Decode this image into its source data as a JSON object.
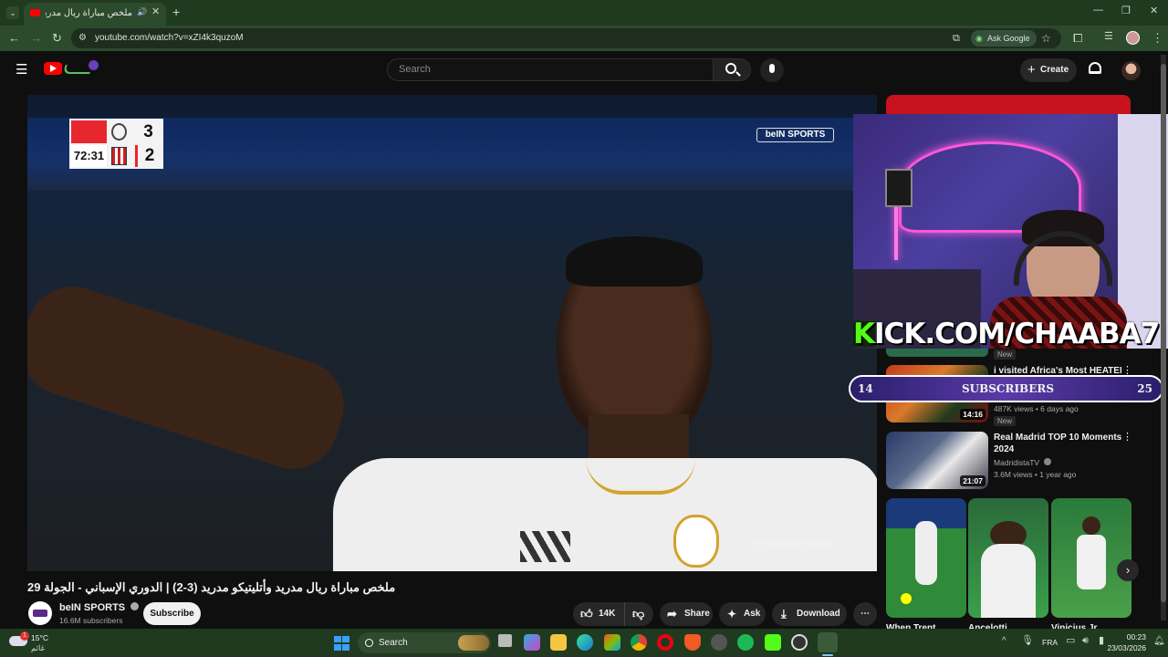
{
  "browser": {
    "tab_title": "ملخص مباراة ريال مدريد وأتل",
    "url": "youtube.com/watch?v=xZI4k3quzoM",
    "ask_google": "Ask Google",
    "new_tab_symbol": "+"
  },
  "youtube": {
    "search_placeholder": "Search",
    "create_label": "Create"
  },
  "video": {
    "score_home": "3",
    "score_away": "2",
    "clock": "72:31",
    "broadcaster_logo": "beIN SPORTS",
    "watermark": "@RealMadridAtleti",
    "title": "ملخص مباراة ريال مدريد وأتليتيكو مدريد (3-2) | الدوري الإسباني - الجولة 29"
  },
  "channel": {
    "name": "beIN SPORTS",
    "subscribers": "16.6M subscribers",
    "subscribe_label": "Subscribe"
  },
  "actions": {
    "likes": "14K",
    "share": "Share",
    "ask": "Ask",
    "download": "Download"
  },
  "overlay": {
    "kick_url": "KICK.COM/CHAABA7",
    "subs_left": "14",
    "subs_label": "SUBSCRIBERS",
    "subs_right": "25"
  },
  "sidebar": {
    "items": [
      {
        "badge_top": "New",
        "title": "i visited Africa's Most HEATED",
        "meta": "487K views • 6 days ago",
        "badge": "New",
        "duration": "14:16"
      },
      {
        "title_line1": "Real Madrid TOP 10 Moments",
        "title_line2": "2024",
        "channel": "MadridistaTV",
        "meta": "3.6M views • 1 year ago",
        "duration": "21:07"
      }
    ],
    "shorts": [
      {
        "title": "When Trent"
      },
      {
        "title": "Ancelotti"
      },
      {
        "title": "Vinicius Jr"
      }
    ]
  },
  "taskbar": {
    "temperature": "15°C",
    "weather_label": "غائم",
    "weather_badge": "1",
    "search": "Search",
    "language": "FRA",
    "time": "00:23",
    "date": "23/03/2026"
  }
}
